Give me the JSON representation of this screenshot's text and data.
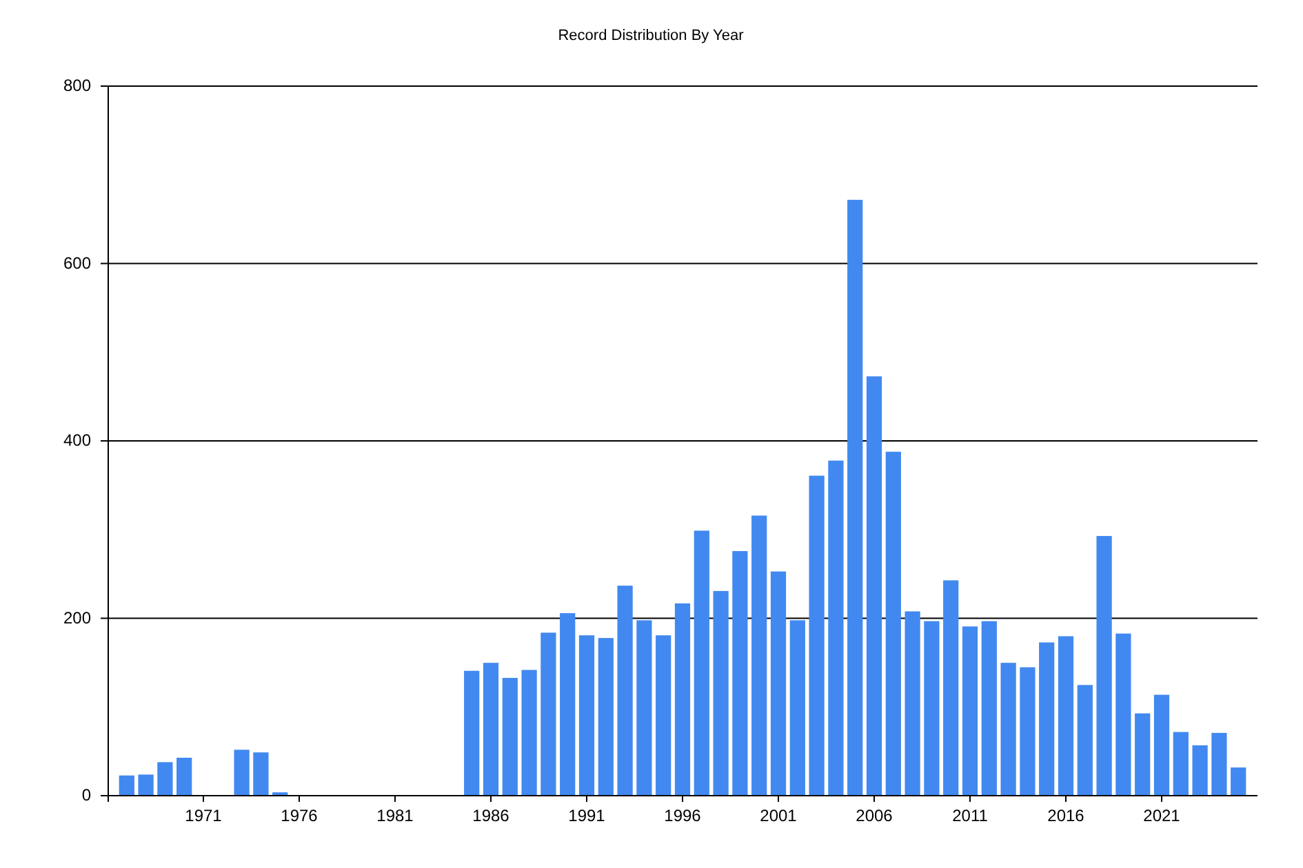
{
  "chart": {
    "chart_data": {
      "type": "bar",
      "title": "Record Distribution By Year",
      "x": [
        1967,
        1968,
        1969,
        1970,
        1971,
        1972,
        1973,
        1974,
        1975,
        1976,
        1977,
        1978,
        1979,
        1980,
        1981,
        1982,
        1983,
        1984,
        1985,
        1986,
        1987,
        1988,
        1989,
        1990,
        1991,
        1992,
        1993,
        1994,
        1995,
        1996,
        1997,
        1998,
        1999,
        2000,
        2001,
        2002,
        2003,
        2004,
        2005,
        2006,
        2007,
        2008,
        2009,
        2010,
        2011,
        2012,
        2013,
        2014,
        2015,
        2016,
        2017,
        2018,
        2019,
        2020,
        2021,
        2022,
        2023,
        2024,
        2025
      ],
      "values": [
        22,
        23,
        37,
        42,
        0,
        0,
        51,
        48,
        3,
        0,
        0,
        0,
        0,
        0,
        0,
        0,
        0,
        0,
        140,
        149,
        132,
        141,
        183,
        205,
        180,
        177,
        236,
        197,
        180,
        216,
        298,
        230,
        275,
        315,
        252,
        197,
        360,
        377,
        671,
        472,
        387,
        207,
        196,
        242,
        190,
        196,
        149,
        144,
        172,
        179,
        124,
        292,
        182,
        92,
        113,
        71,
        56,
        70,
        31
      ],
      "xlim": [
        1966,
        2026
      ],
      "ylim": [
        0,
        800
      ],
      "xticks": [
        1971,
        1976,
        1981,
        1986,
        1991,
        1996,
        2001,
        2006,
        2011,
        2016,
        2021
      ],
      "yticks": [
        0,
        200,
        400,
        600,
        800
      ],
      "grid": true
    }
  }
}
